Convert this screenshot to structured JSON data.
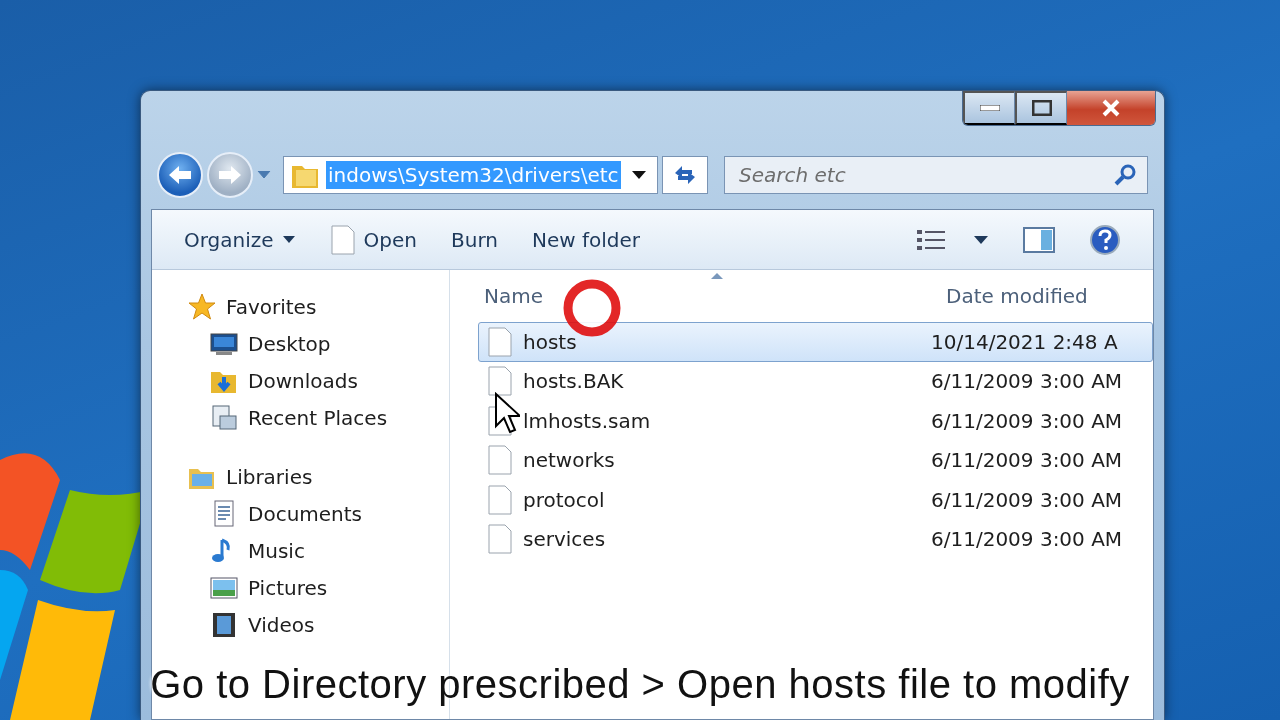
{
  "address": {
    "path": "indows\\System32\\drivers\\etc",
    "selected": true
  },
  "search": {
    "placeholder": "Search etc"
  },
  "toolbar": [
    {
      "label": "Organize",
      "kind": "menu"
    },
    {
      "label": "Open",
      "kind": "file"
    },
    {
      "label": "Burn",
      "kind": "plain"
    },
    {
      "label": "New folder",
      "kind": "plain"
    }
  ],
  "sidebar": [
    {
      "label": "Favorites",
      "kind": "star",
      "children": [
        {
          "label": "Desktop",
          "kind": "desktop"
        },
        {
          "label": "Downloads",
          "kind": "downloads"
        },
        {
          "label": "Recent Places",
          "kind": "recent"
        }
      ]
    },
    {
      "label": "Libraries",
      "kind": "library",
      "children": [
        {
          "label": "Documents",
          "kind": "documents"
        },
        {
          "label": "Music",
          "kind": "music"
        },
        {
          "label": "Pictures",
          "kind": "pictures"
        },
        {
          "label": "Videos",
          "kind": "videos"
        }
      ]
    }
  ],
  "columns": [
    {
      "label": "Name"
    },
    {
      "label": "Date modified"
    }
  ],
  "files": [
    {
      "name": "hosts",
      "date": "10/14/2021 2:48 A",
      "selected": true
    },
    {
      "name": "hosts.BAK",
      "date": "6/11/2009 3:00 AM",
      "selected": false
    },
    {
      "name": "lmhosts.sam",
      "date": "6/11/2009 3:00 AM",
      "selected": false
    },
    {
      "name": "networks",
      "date": "6/11/2009 3:00 AM",
      "selected": false
    },
    {
      "name": "protocol",
      "date": "6/11/2009 3:00 AM",
      "selected": false
    },
    {
      "name": "services",
      "date": "6/11/2009 3:00 AM",
      "selected": false
    }
  ],
  "caption": "Go to Directory prescribed > Open hosts file to modify"
}
